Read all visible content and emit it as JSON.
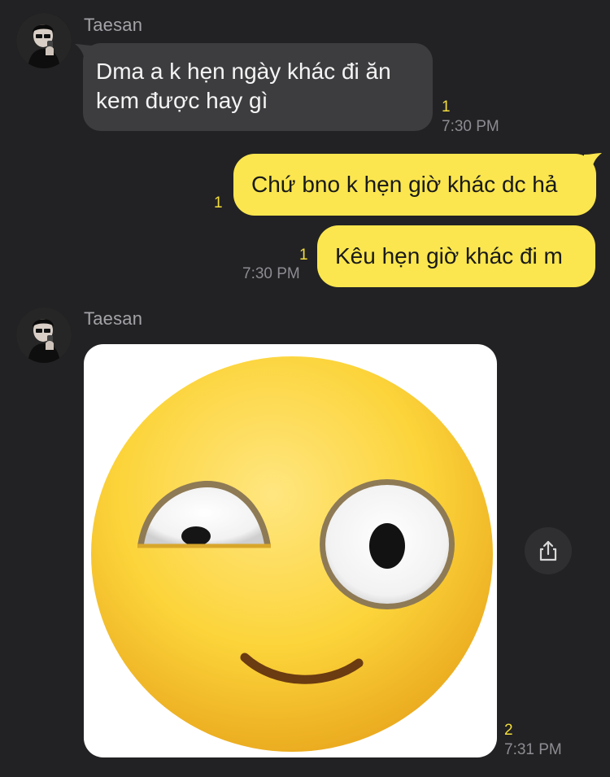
{
  "messages": [
    {
      "type": "incoming",
      "sender": "Taesan",
      "text": "Dma a k hẹn ngày khác đi ăn kem được hay gì",
      "unread": "1",
      "time": "7:30 PM"
    },
    {
      "type": "outgoing",
      "text": "Chứ bno k hẹn giờ khác dc hả",
      "unread": "1"
    },
    {
      "type": "outgoing",
      "text": "Kêu hẹn giờ khác đi m",
      "unread": "1",
      "time": "7:30 PM"
    },
    {
      "type": "incoming-image",
      "sender": "Taesan",
      "image": "eye-roll-emoji-image",
      "unread": "2",
      "time": "7:31 PM"
    }
  ],
  "icons": {
    "share": "share-icon",
    "avatar": "profile-avatar"
  },
  "colors": {
    "background": "#222224",
    "incoming_bubble": "#3d3d40",
    "outgoing_bubble": "#fbe64f",
    "unread_count": "#f3dd3c",
    "timestamp": "#8c8c92"
  }
}
